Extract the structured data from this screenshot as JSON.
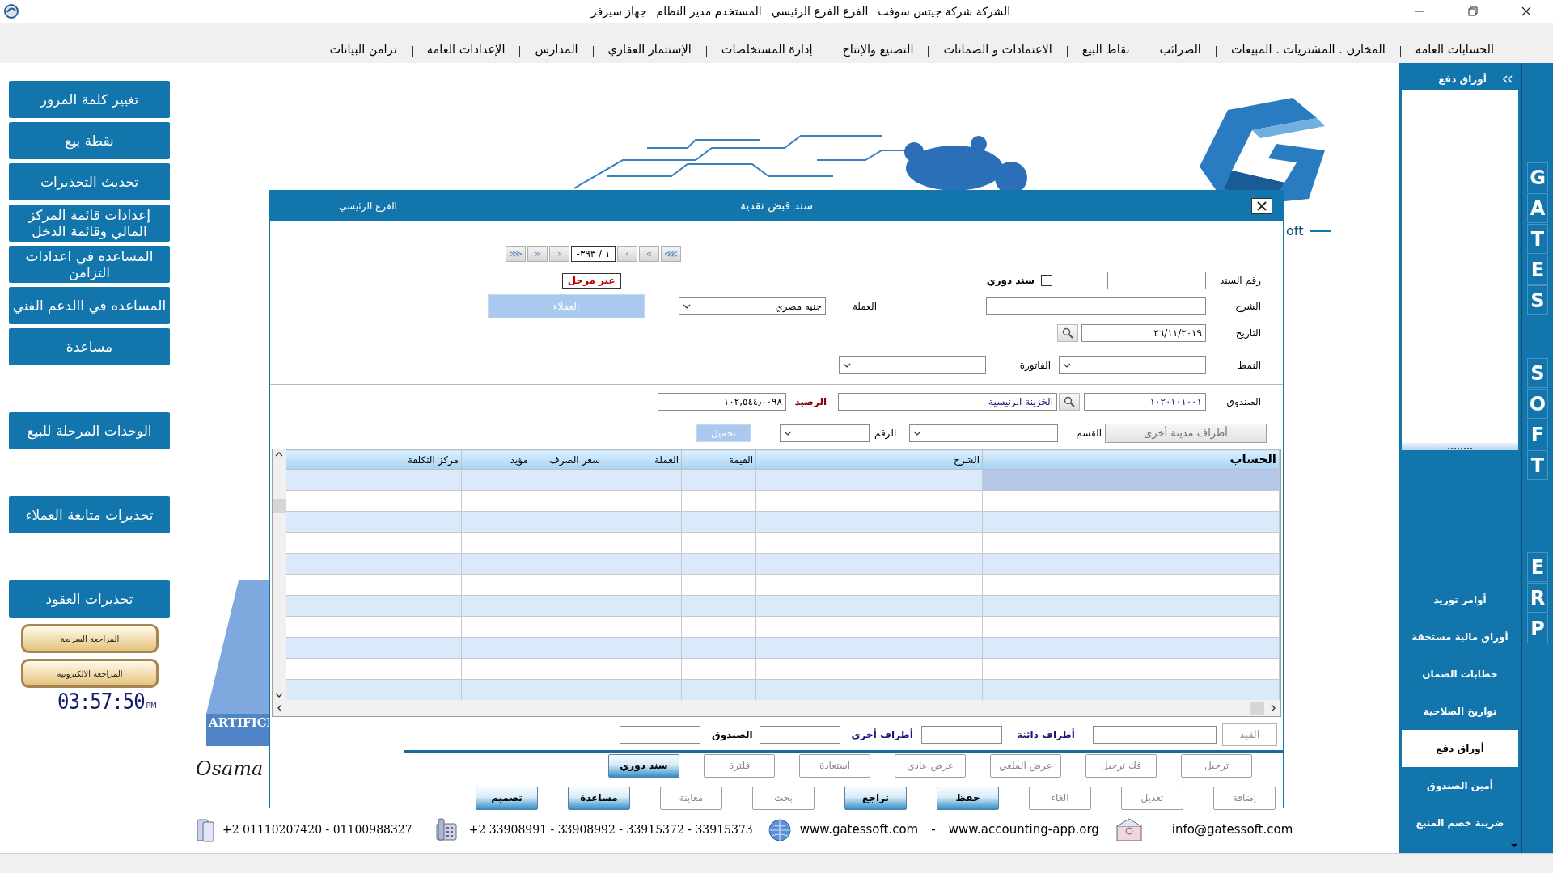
{
  "title_bar": {
    "texts": [
      "الشركة شركة جيتس سوفت",
      "الفرع الفرع الرئيسي",
      "المستخدم مدير النظام",
      "جهاز سيرفر"
    ]
  },
  "menu": [
    "الحسابات العامه",
    "المخازن . المشتريات . المبيعات",
    "الضرائب",
    "نقاط البيع",
    "الاعتمادات و الضمانات",
    "التصنيع والإنتاج",
    "إدارة المستخلصات",
    "الإستثمار العقاري",
    "المدارس",
    "الإعدادات العامه",
    "تزامن البيانات"
  ],
  "left_sidebar": {
    "groups": [
      [
        "تغيير كلمة المرور",
        "نقطة بيع",
        "تحديث التحذيرات",
        "إعدادات قائمة المركز المالي وقائمة الدخل",
        "المساعده في اعدادات التزامن",
        "المساعده في االدعم الفني",
        "مساعدة"
      ],
      [
        "الوحدات المرحلة للبيع"
      ],
      [
        "تحذيرات متابعة العملاء"
      ],
      [
        "تحذيرات العقود"
      ]
    ],
    "review_buttons": [
      "المراجعة السريعة",
      "المراجعة الالكترونية"
    ],
    "clock": "03:57:50",
    "clock_suffix": "PM"
  },
  "background": {
    "brand_fragment": "oft",
    "banner_fragment": "ARTIFICI",
    "signature_fragment": "Osama"
  },
  "dialog": {
    "title": "سند قبض نقدية",
    "branch": "الفرع الرئيسي",
    "nav": {
      "right": [
        "⋙",
        "»",
        "›"
      ],
      "position": "-١ / ٣٩٣",
      "left": [
        "‹",
        "«",
        "⋘"
      ]
    },
    "status": "غير مرحل",
    "voucher_label": "رقم السند",
    "recurring": {
      "label": "سند دوري",
      "checked": false
    },
    "description_label": "الشرح",
    "currency": {
      "label": "العملة",
      "value": "جنيه مصري"
    },
    "customers_button": {
      "label": "العملاء",
      "disabled": true
    },
    "date": {
      "label": "التاريخ",
      "value": "٢٦/١١/٢٠١٩"
    },
    "pattern_label": "النمط",
    "invoice_label": "الفاتورة",
    "cashbox": {
      "label": "الصندوق",
      "code": "١٠٢٠١٠١٠٠١",
      "name": "الخزينة الرئيسية"
    },
    "balance": {
      "label": "الرصيد",
      "value": "١٠٢,٥٤٤٫٠٠٩٨"
    },
    "other_debit_button": {
      "label": "أطراف مدينة أخرى",
      "disabled": true
    },
    "section_label": "القسم",
    "number_label": "الرقم",
    "load_button": {
      "label": "تحميل",
      "disabled": true
    },
    "grid": {
      "columns": [
        "الحساب",
        "الشرح",
        "القيمة",
        "العملة",
        "سعر الصرف",
        "مؤيد",
        "مركز التكلفة"
      ],
      "rows": [
        {
          "selected": true
        },
        {
          "selected": false
        },
        {
          "selected": false
        },
        {
          "selected": false
        },
        {
          "selected": false
        },
        {
          "selected": false
        },
        {
          "selected": false
        },
        {
          "selected": false
        },
        {
          "selected": false
        },
        {
          "selected": false
        },
        {
          "selected": false
        }
      ]
    },
    "totals": {
      "entry_button": {
        "label": "القيد",
        "disabled": true
      },
      "credit_label": "أطراف دائنة",
      "other_label": "أطراف أخرى",
      "cashbox_label": "الصندوق"
    },
    "action_rows": [
      [
        {
          "label": "ترحيل",
          "active": false
        },
        {
          "label": "فك ترحيل",
          "active": false
        },
        {
          "label": "عرض الملغي",
          "active": false
        },
        {
          "label": "عرض عادي",
          "active": false
        },
        {
          "label": "استعادة",
          "active": false
        },
        {
          "label": "فلترة",
          "active": false
        },
        {
          "label": "سند دوري",
          "active": true
        }
      ],
      [
        {
          "label": "إضافة",
          "active": false
        },
        {
          "label": "تعديل",
          "active": false
        },
        {
          "label": "الغاء",
          "active": false
        },
        {
          "label": "حفظ",
          "active": true
        },
        {
          "label": "تراجع",
          "active": true
        },
        {
          "label": "بحث",
          "active": false
        },
        {
          "label": "معاينة",
          "active": false
        },
        {
          "label": "مساعدة",
          "active": true
        },
        {
          "label": "تصميم",
          "active": true
        }
      ]
    ]
  },
  "right_panel": {
    "header": "أوراق دفع",
    "items": [
      {
        "label": "أوامر توريد",
        "selected": false
      },
      {
        "label": "أوراق مالية مستحقة",
        "selected": false
      },
      {
        "label": "خطابات الضمان",
        "selected": false
      },
      {
        "label": "تواريخ الصلاحية",
        "selected": false
      },
      {
        "label": "أوراق دفع",
        "selected": true
      },
      {
        "label": "أمين الصندوق",
        "selected": false
      },
      {
        "label": "ضريبة خصم المنبع",
        "selected": false
      }
    ]
  },
  "brand_letters": [
    [
      "G",
      "A",
      "T",
      "E",
      "S"
    ],
    [
      "S",
      "O",
      "F",
      "T"
    ],
    [
      "E",
      "R",
      "P"
    ]
  ],
  "footer": {
    "mobile": "+2 01110207420  - 01100988327",
    "phones": "+2 33908991 - 33908992 -  33915372 - 33915373",
    "website": "www.gatessoft.com",
    "separator": "-",
    "website_alt": "www.accounting-app.org",
    "email": "info@gatessoft.com"
  }
}
